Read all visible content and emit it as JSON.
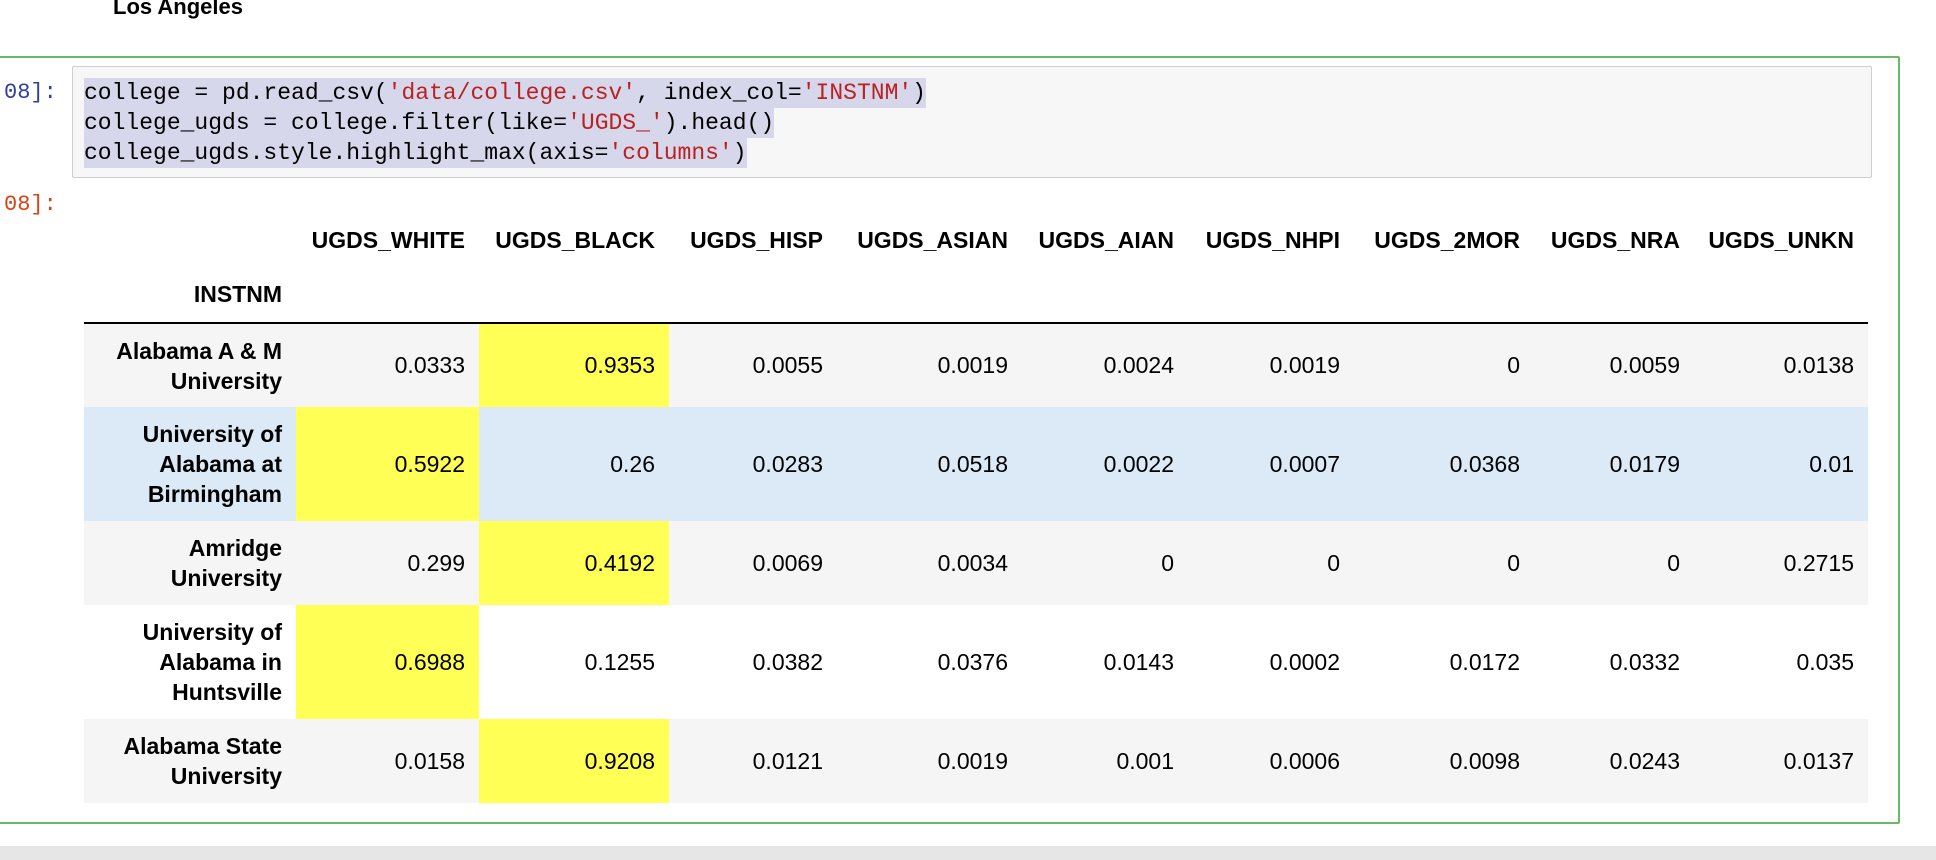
{
  "previous_output": {
    "text": "Los Angeles"
  },
  "cell": {
    "in_prompt": "08]:",
    "out_prompt": "08]:",
    "code_lines": [
      {
        "parts": [
          "college = pd.read_csv(",
          "'data/college.csv'",
          ", index_col=",
          "'INSTNM'",
          ")"
        ]
      },
      {
        "parts": [
          "college_ugds = college.filter(like=",
          "'UGDS_'",
          ").head()",
          "",
          ""
        ]
      },
      {
        "parts": [
          "college_ugds.style.highlight_max(axis=",
          "'columns'",
          ")",
          "",
          ""
        ]
      }
    ]
  },
  "dataframe": {
    "index_name": "INSTNM",
    "columns": [
      "UGDS_WHITE",
      "UGDS_BLACK",
      "UGDS_HISP",
      "UGDS_ASIAN",
      "UGDS_AIAN",
      "UGDS_NHPI",
      "UGDS_2MOR",
      "UGDS_NRA",
      "UGDS_UNKN"
    ],
    "rows": [
      {
        "index": "Alabama A & M University",
        "values": [
          "0.0333",
          "0.9353",
          "0.0055",
          "0.0019",
          "0.0024",
          "0.0019",
          "0",
          "0.0059",
          "0.0138"
        ],
        "max_col": 1
      },
      {
        "index": "University of Alabama at Birmingham",
        "values": [
          "0.5922",
          "0.26",
          "0.0283",
          "0.0518",
          "0.0022",
          "0.0007",
          "0.0368",
          "0.0179",
          "0.01"
        ],
        "max_col": 0
      },
      {
        "index": "Amridge University",
        "values": [
          "0.299",
          "0.4192",
          "0.0069",
          "0.0034",
          "0",
          "0",
          "0",
          "0",
          "0.2715"
        ],
        "max_col": 1
      },
      {
        "index": "University of Alabama in Huntsville",
        "values": [
          "0.6988",
          "0.1255",
          "0.0382",
          "0.0376",
          "0.0143",
          "0.0002",
          "0.0172",
          "0.0332",
          "0.035"
        ],
        "max_col": 0
      },
      {
        "index": "Alabama State University",
        "values": [
          "0.0158",
          "0.9208",
          "0.0121",
          "0.0019",
          "0.001",
          "0.0006",
          "0.0098",
          "0.0243",
          "0.0137"
        ],
        "max_col": 1
      }
    ]
  },
  "colors": {
    "highlight": "#ffff55",
    "hover_row": "#dceaf8",
    "cell_border": "#66bb6a",
    "string_literal": "#ba2121",
    "in_prompt": "#303f9f",
    "out_prompt": "#d84315"
  }
}
